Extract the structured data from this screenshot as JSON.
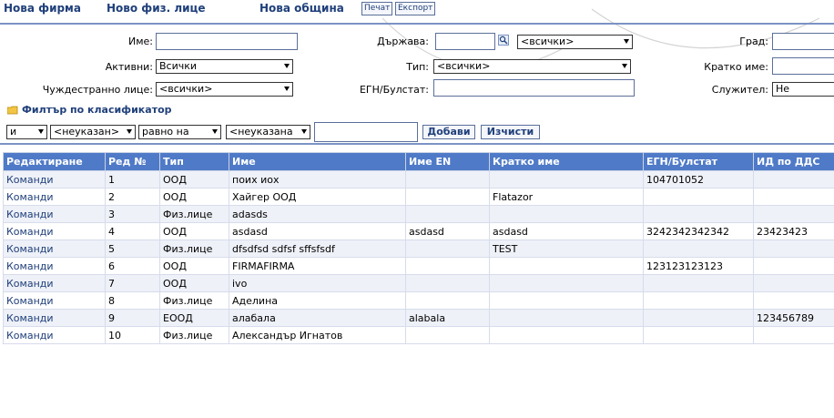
{
  "top_links": {
    "new_firm": "Нова фирма",
    "new_person": "Ново физ. лице",
    "new_municipality": "Нова община",
    "print": "Печат",
    "export": "Експорт"
  },
  "filters": {
    "name_label": "Име:",
    "name_value": "",
    "country_label": "Държава:",
    "country_value": "",
    "country_select": "<всички>",
    "city_label": "Град:",
    "active_label": "Активни:",
    "active_value": "Всички",
    "type_label": "Тип:",
    "type_value": "<всички>",
    "short_name_label": "Кратко име:",
    "foreign_label": "Чуждестранно лице:",
    "foreign_value": "<всички>",
    "egn_label": "ЕГН/Булстат:",
    "employee_label": "Служител:",
    "employee_value": "Не"
  },
  "classifier": {
    "title": "Филтър по класификатор",
    "logic_value": "и",
    "field_value": "<неуказан>",
    "operator_value": "равно на",
    "value_select": "<неуказана",
    "add_button": "Добави",
    "clear_button": "Изчисти"
  },
  "table": {
    "columns": [
      "Редактиране",
      "Ред №",
      "Тип",
      "Име",
      "Име EN",
      "Кратко име",
      "ЕГН/Булстат",
      "ИД по ДДС"
    ],
    "rows": [
      [
        "Команди",
        "1",
        "ООД",
        "поих иох",
        "",
        "",
        "104701052",
        ""
      ],
      [
        "Команди",
        "2",
        "ООД",
        "Хайгер ООД",
        "",
        "Flatazor",
        "",
        ""
      ],
      [
        "Команди",
        "3",
        "Физ.лице",
        "adasds",
        "",
        "",
        "",
        ""
      ],
      [
        "Команди",
        "4",
        "ООД",
        "asdasd",
        "asdasd",
        "asdasd",
        "3242342342342",
        "23423423"
      ],
      [
        "Команди",
        "5",
        "Физ.лице",
        "dfsdfsd sdfsf sffsfsdf",
        "",
        "TEST",
        "",
        ""
      ],
      [
        "Команди",
        "6",
        "ООД",
        "FIRMAFIRMA",
        "",
        "",
        "123123123123",
        ""
      ],
      [
        "Команди",
        "7",
        "ООД",
        "ivo",
        "",
        "",
        "",
        ""
      ],
      [
        "Команди",
        "8",
        "Физ.лице",
        "Аделина",
        "",
        "",
        "",
        ""
      ],
      [
        "Команди",
        "9",
        "ЕООД",
        "алабала",
        "alabala",
        "",
        "",
        "123456789"
      ],
      [
        "Команди",
        "10",
        "Физ.лице",
        "Александър Игнатов",
        "",
        "",
        "",
        ""
      ]
    ]
  }
}
